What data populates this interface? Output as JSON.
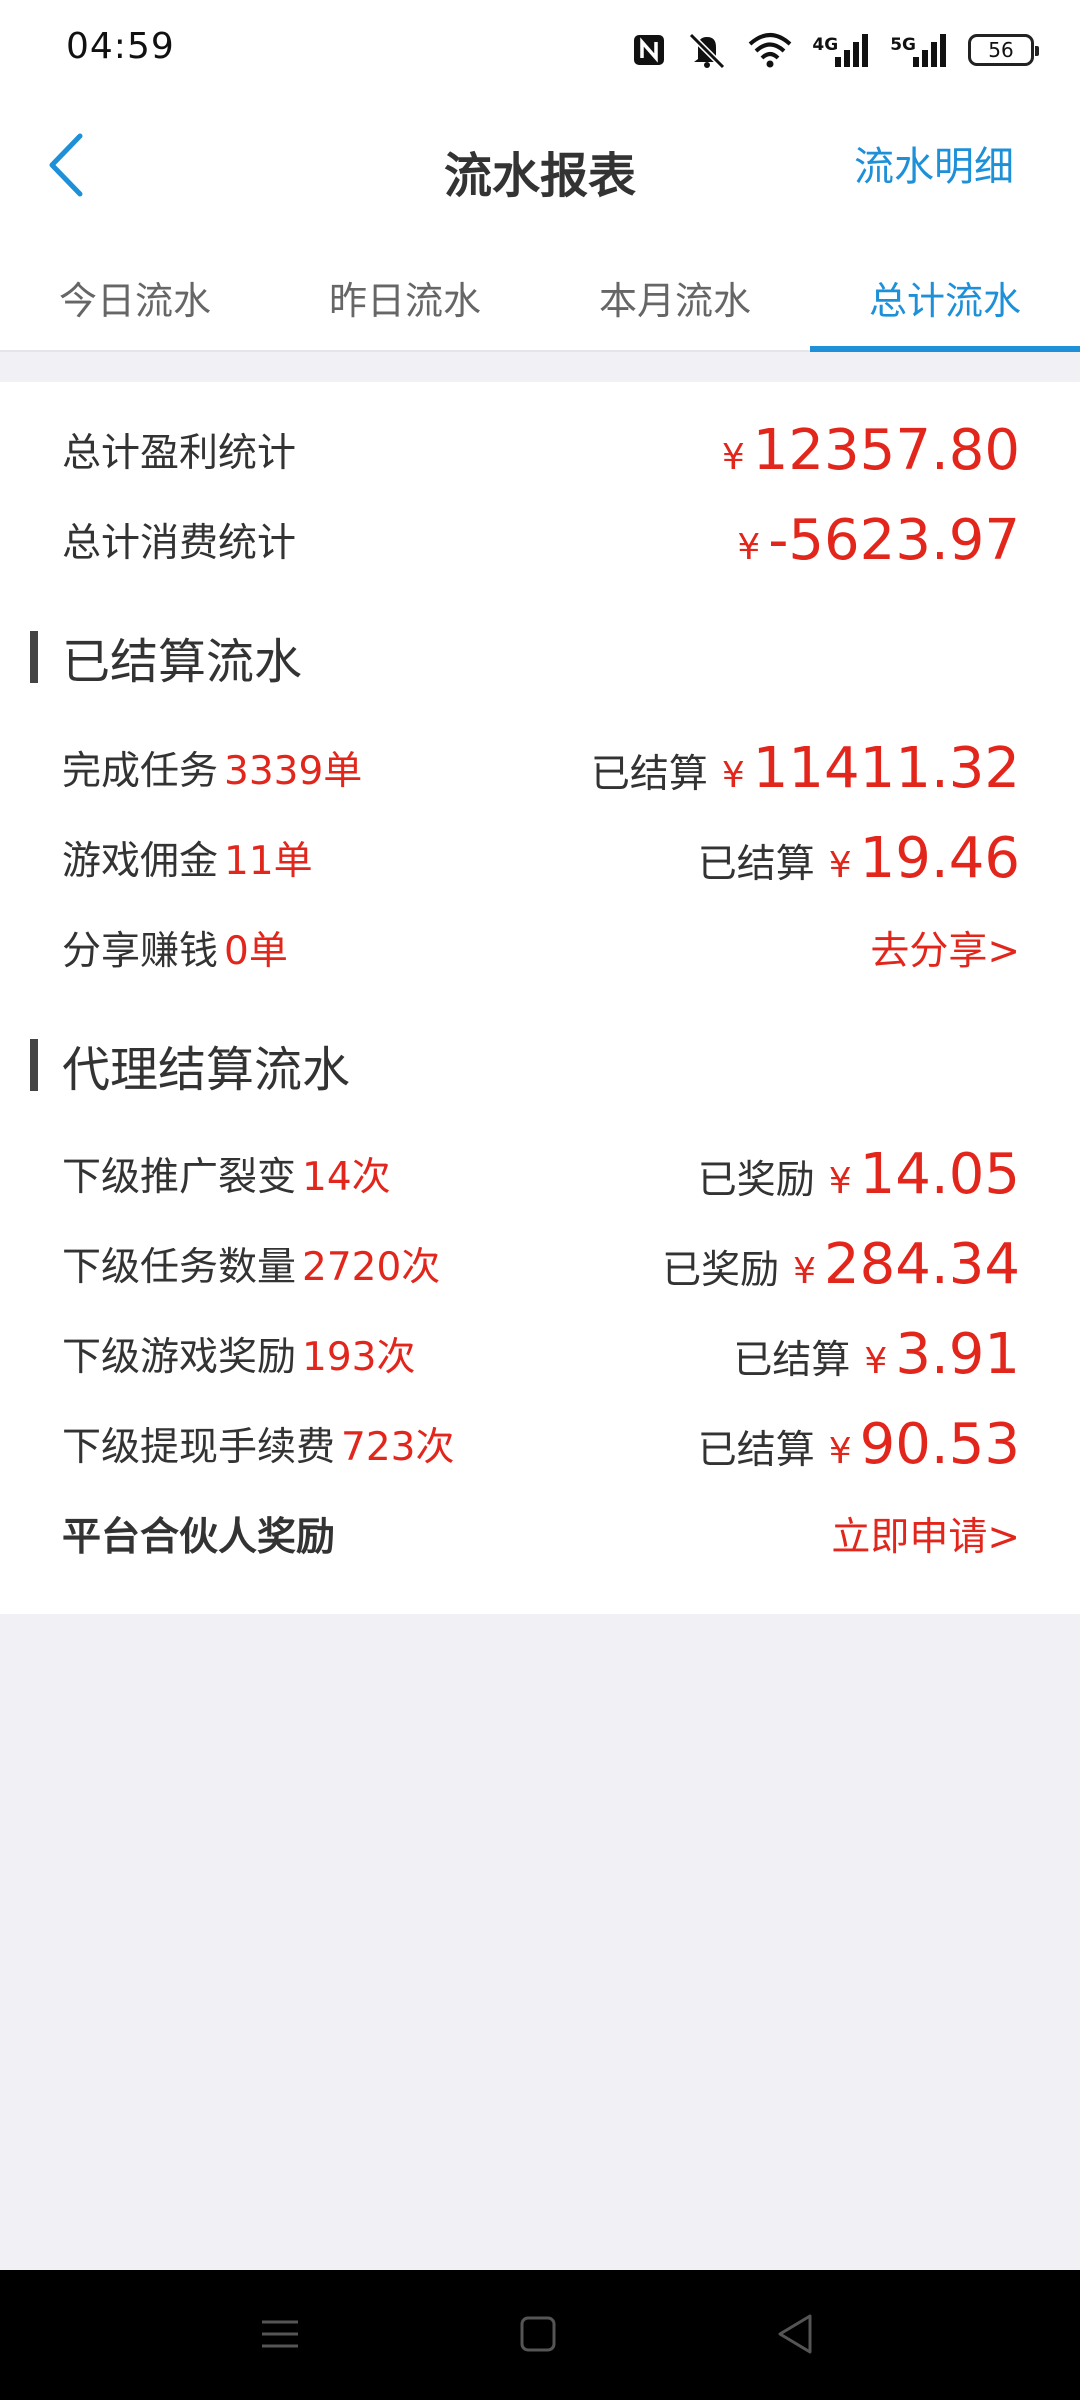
{
  "status_bar": {
    "time": "04:59",
    "icons": [
      "nfc-icon",
      "mute-icon",
      "wifi-icon",
      "signal-4g-icon",
      "signal-5g-icon",
      "battery-icon"
    ],
    "sig1_label": "4G",
    "sig2_label": "5G",
    "battery": "56"
  },
  "header": {
    "title": "流水报表",
    "detail_link": "流水明细"
  },
  "tabs": [
    {
      "label": "今日流水",
      "active": false
    },
    {
      "label": "昨日流水",
      "active": false
    },
    {
      "label": "本月流水",
      "active": false
    },
    {
      "label": "总计流水",
      "active": true
    }
  ],
  "summary": {
    "profit_label": "总计盈利统计",
    "profit_currency": "¥",
    "profit_value": "12357.80",
    "consume_label": "总计消费统计",
    "consume_currency": "¥",
    "consume_value": "-5623.97"
  },
  "settled_section": {
    "title": "已结算流水",
    "rows": [
      {
        "label": "完成任务",
        "count": "3339单",
        "status": "已结算",
        "currency": "¥",
        "amount": "11411.32"
      },
      {
        "label": "游戏佣金",
        "count": "11单",
        "status": "已结算",
        "currency": "¥",
        "amount": "19.46"
      },
      {
        "label": "分享赚钱",
        "count": "0单",
        "action": "去分享>"
      }
    ]
  },
  "agent_section": {
    "title": "代理结算流水",
    "rows": [
      {
        "label": "下级推广裂变",
        "count": "14次",
        "status": "已奖励",
        "currency": "¥",
        "amount": "14.05"
      },
      {
        "label": "下级任务数量",
        "count": "2720次",
        "status": "已奖励",
        "currency": "¥",
        "amount": "284.34"
      },
      {
        "label": "下级游戏奖励",
        "count": "193次",
        "status": "已结算",
        "currency": "¥",
        "amount": "3.91"
      },
      {
        "label": "下级提现手续费",
        "count": "723次",
        "status": "已结算",
        "currency": "¥",
        "amount": "90.53"
      },
      {
        "label": "平台合伙人奖励",
        "action": "立即申请>"
      }
    ]
  },
  "nav_bar": {
    "buttons": [
      "menu-icon",
      "home-icon",
      "back-triangle-icon"
    ]
  },
  "colors": {
    "accent": "#1e90d8",
    "amount_red": "#e2261c",
    "background": "#f0f0f5"
  }
}
